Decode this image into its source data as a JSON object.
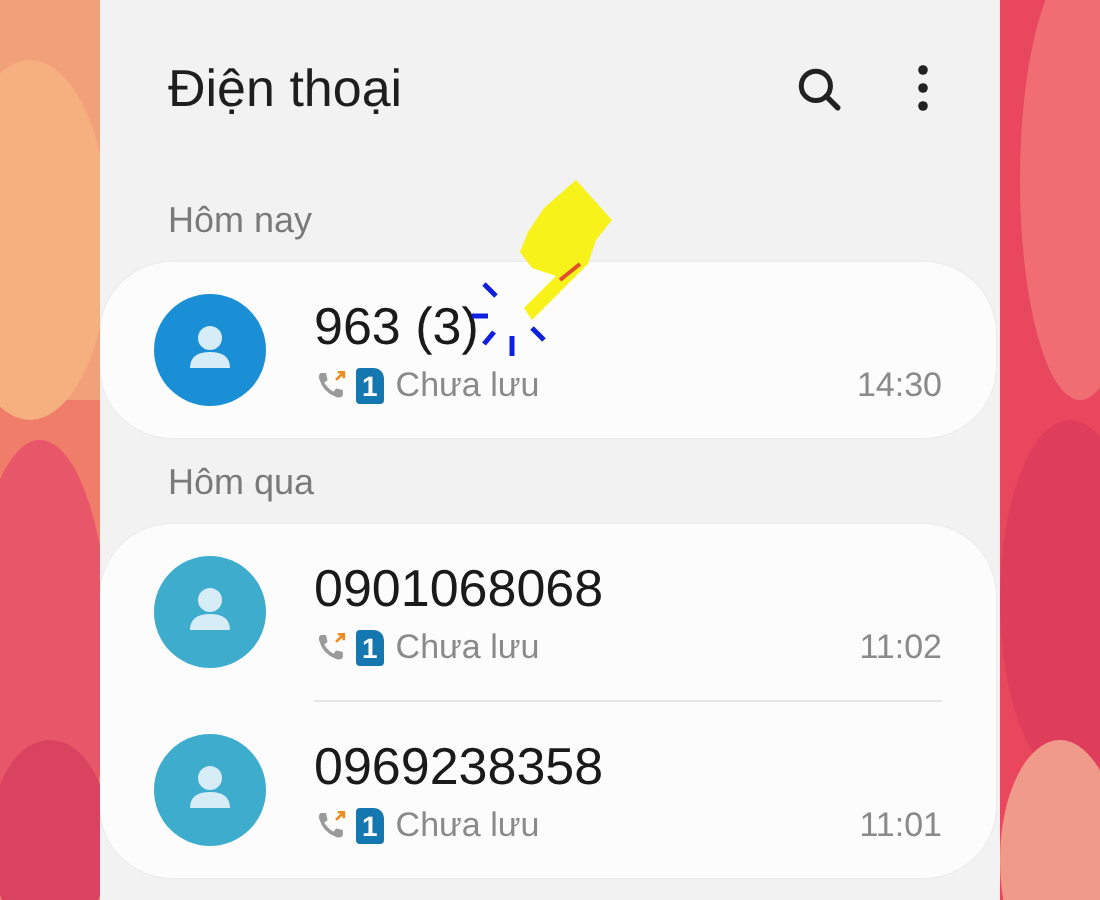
{
  "app": {
    "title": "Điện thoại"
  },
  "groups": [
    {
      "label": "Hôm nay",
      "calls": [
        {
          "name": "963 (3)",
          "sim": "1",
          "status": "Chưa lưu",
          "time": "14:30",
          "color": "#1b8fd6"
        }
      ]
    },
    {
      "label": "Hôm qua",
      "calls": [
        {
          "name": "0901068068",
          "sim": "1",
          "status": "Chưa lưu",
          "time": "11:02",
          "color": "#3eaccc"
        },
        {
          "name": "0969238358",
          "sim": "1",
          "status": "Chưa lưu",
          "time": "11:01",
          "color": "#3eaccc"
        }
      ]
    }
  ]
}
